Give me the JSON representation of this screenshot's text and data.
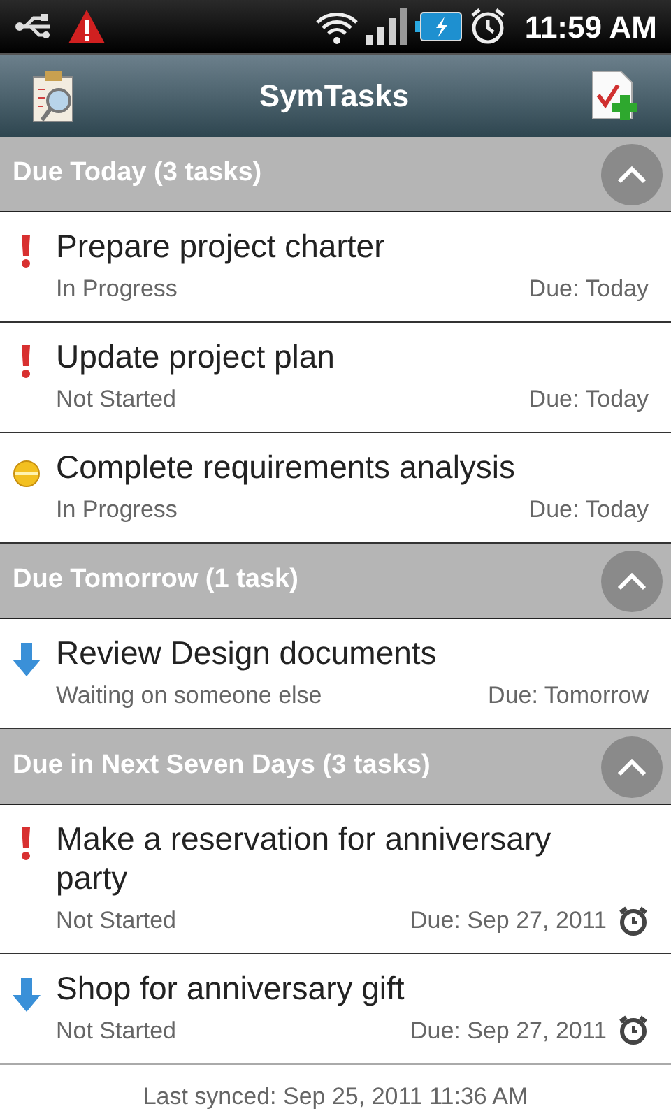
{
  "status_bar": {
    "time": "11:59 AM"
  },
  "app_bar": {
    "title": "SymTasks"
  },
  "sections": [
    {
      "title": "Due Today (3 tasks)",
      "expanded": true,
      "tasks": [
        {
          "title": "Prepare project charter",
          "kind": "high",
          "status": "In Progress",
          "due": "Due: Today",
          "alarm": false
        },
        {
          "title": "Update project plan",
          "kind": "high",
          "status": "Not Started",
          "due": "Due: Today",
          "alarm": false
        },
        {
          "title": "Complete requirements analysis",
          "kind": "medium",
          "status": "In Progress",
          "due": "Due: Today",
          "alarm": false
        }
      ]
    },
    {
      "title": "Due Tomorrow (1 task)",
      "expanded": true,
      "tasks": [
        {
          "title": "Review Design documents",
          "kind": "low",
          "status": "Waiting on someone else",
          "due": "Due: Tomorrow",
          "alarm": false
        }
      ]
    },
    {
      "title": "Due in Next Seven Days (3 tasks)",
      "expanded": true,
      "tasks": [
        {
          "title": "Make a reservation for anniversary party",
          "kind": "high",
          "status": "Not Started",
          "due": "Due: Sep 27, 2011",
          "alarm": true
        },
        {
          "title": "Shop for anniversary gift",
          "kind": "low",
          "status": "Not Started",
          "due": "Due: Sep 27, 2011",
          "alarm": true
        }
      ]
    }
  ],
  "footer": "Last synced: Sep 25, 2011 11:36 AM"
}
